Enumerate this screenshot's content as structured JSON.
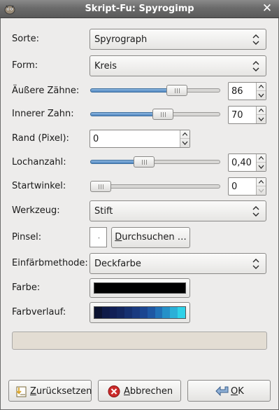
{
  "window": {
    "title": "Skript-Fu: Spyrogimp"
  },
  "labels": {
    "sorte": "Sorte:",
    "form": "Form:",
    "aeussere_zaehne": "Äußere Zähne:",
    "innerer_zahn": "Innerer Zahn:",
    "rand": "Rand (Pixel):",
    "lochanzahl": "Lochanzahl:",
    "startwinkel": "Startwinkel:",
    "werkzeug": "Werkzeug:",
    "pinsel": "Pinsel:",
    "einfaerbmethode": "Einfärbmethode:",
    "farbe": "Farbe:",
    "farbverlauf": "Farbverlauf:"
  },
  "fields": {
    "sorte": "Spyrograph",
    "form": "Kreis",
    "aeussere_zaehne": {
      "value": "86",
      "fraction": 0.7
    },
    "innerer_zahn": {
      "value": "70",
      "fraction": 0.57
    },
    "rand": "0",
    "lochanzahl": {
      "value": "0,40",
      "fraction": 0.4
    },
    "startwinkel": {
      "value": "0",
      "fraction": 0.0
    },
    "werkzeug": "Stift",
    "einfaerbmethode": "Deckfarbe",
    "farbe_color": "#000000",
    "farbverlauf_colors": [
      "#0b1230",
      "#0e1a48",
      "#111f56",
      "#13265f",
      "#163070",
      "#1a3a80",
      "#1b4590",
      "#1e57a3",
      "#2171b7",
      "#2590c8",
      "#2bb0d8",
      "#2fd1e8"
    ]
  },
  "buttons": {
    "durchsuchen_prefix": "D",
    "durchsuchen_rest": "urchsuchen …",
    "reset_prefix": "Z",
    "reset_rest": "urücksetzen",
    "cancel_prefix": "A",
    "cancel_rest": "bbrechen",
    "ok_prefix": "O",
    "ok_rest": "K"
  },
  "icons": {
    "window_menu": "gimp-wilber-icon",
    "close": "close-icon",
    "reset": "reset-icon",
    "cancel": "cancel-icon",
    "ok": "ok-arrow-icon"
  }
}
